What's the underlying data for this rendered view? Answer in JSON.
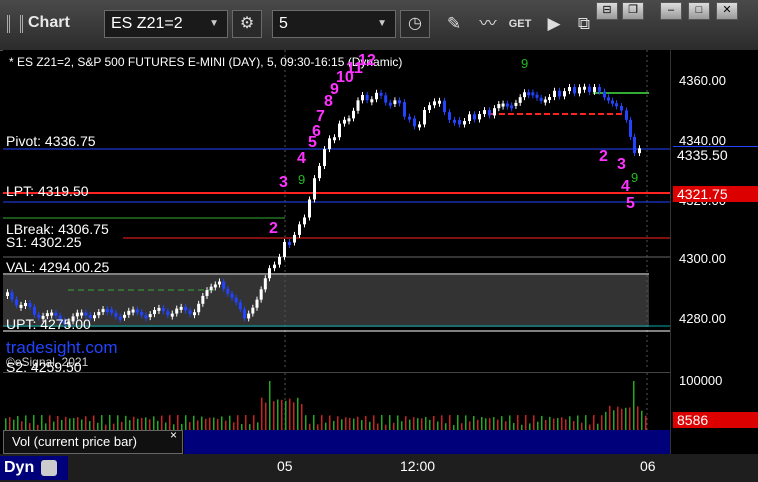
{
  "window": {
    "title": "Chart",
    "symbol": "ES Z21=2",
    "interval": "5"
  },
  "toolbar": {
    "icons": [
      "gear-icon",
      "clock-icon",
      "pencil-icon",
      "line-chart-icon",
      "get-icon",
      "play-icon",
      "export-icon"
    ]
  },
  "window_controls": [
    "pin",
    "restore",
    "maximize",
    "close"
  ],
  "info_line": "* ES Z21=2, S&P 500 FUTURES E-MINI (DAY), 5, 09:30-16:15 (Dynamic)",
  "levels": {
    "pivot": "Pivot: 4336.75",
    "lpt": "LPT: 4319.50",
    "lbreak": "LBreak: 4306.75",
    "s1": "S1: 4302.25",
    "val": "VAL: 4294.00.25",
    "upt": "UPT: 4275.00",
    "s2": "S2: 4259.50"
  },
  "watermark": "tradesight.com",
  "copyright": "©eSignal, 2021",
  "price_axis": {
    "ticks": [
      "4360.00",
      "4340.00",
      "4320.00",
      "4300.00",
      "4280.00"
    ],
    "current_price": "4335.50",
    "lpt_tag": "4321.75"
  },
  "volume": {
    "tick": "100000",
    "current": "8586",
    "tab_label": "Vol (current price bar)",
    "close_symbol": "×"
  },
  "x_axis": {
    "labels": [
      "05",
      "12:00",
      "06"
    ]
  },
  "footer": {
    "dyn_label": "Dyn"
  },
  "overlay_numbers": {
    "up": [
      "2",
      "3",
      "4",
      "5",
      "6",
      "7",
      "8",
      "9",
      "10",
      "11",
      "12"
    ],
    "down": [
      "2",
      "3",
      "4",
      "5"
    ]
  },
  "colors": {
    "pivot": "#2244ff",
    "lpt": "#ff2222",
    "lbreak": "#33aa33",
    "s1": "#ff2222",
    "val": "#ffffff",
    "upt": "#00aaaa",
    "up_bar": "#ffffff",
    "down_bar": "#2244ff",
    "setup_numbers": "#ff33ff"
  }
}
